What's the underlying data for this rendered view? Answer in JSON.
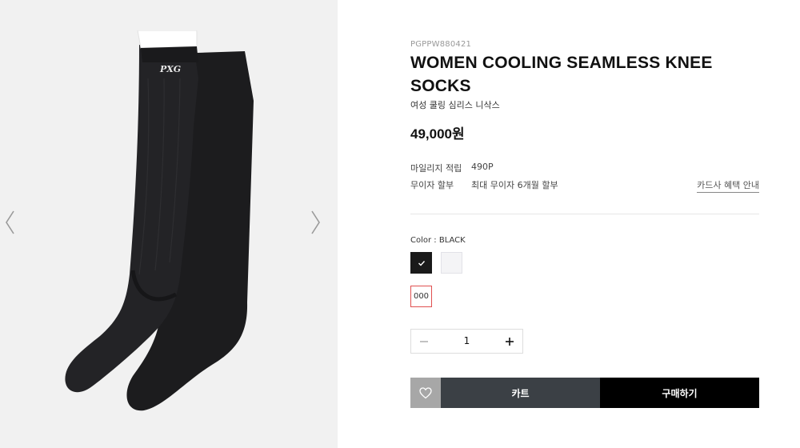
{
  "gallery": {
    "prev_icon": "chevron-left-icon",
    "next_icon": "chevron-right-icon",
    "product_image": "black-knee-socks-image",
    "logo_text": "PXG"
  },
  "product": {
    "sku": "PGPPW880421",
    "title": "WOMEN COOLING SEAMLESS KNEE SOCKS",
    "subtitle": "여성 쿨링 심리스 니삭스",
    "price": "49,000원"
  },
  "benefits": {
    "mileage_label": "마일리지 적립",
    "mileage_value": "490P",
    "installment_label": "무이자 할부",
    "installment_value": "최대 무이자 6개월 할부",
    "card_benefit_link": "카드사 혜택 안내"
  },
  "options": {
    "color_label": "Color : BLACK",
    "colors": [
      {
        "name": "black",
        "hex": "#1a1a1a",
        "selected": true
      },
      {
        "name": "white",
        "hex": "#f4f4f6",
        "selected": false
      }
    ],
    "size_label": "000"
  },
  "quantity": {
    "value": "1",
    "minus_icon": "minus-icon",
    "plus_icon": "plus-icon"
  },
  "actions": {
    "wishlist_icon": "heart-icon",
    "cart_label": "카트",
    "buy_label": "구매하기"
  },
  "colors": {
    "cart_bg": "#3b4045",
    "buy_bg": "#000000",
    "wish_bg": "#a7a7a7",
    "size_border": "#e05050"
  }
}
